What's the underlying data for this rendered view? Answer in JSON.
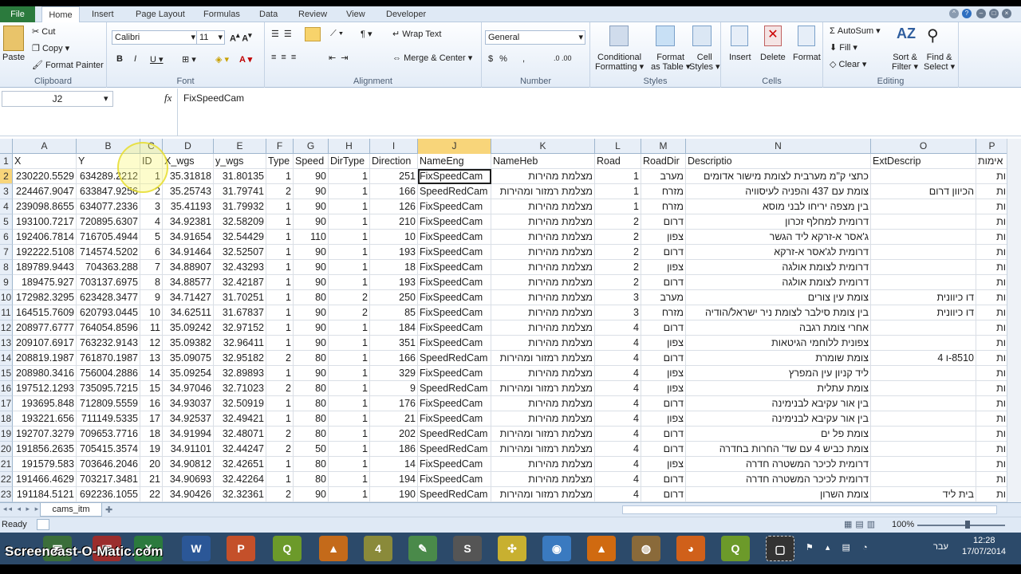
{
  "tabs": [
    "File",
    "Home",
    "Insert",
    "Page Layout",
    "Formulas",
    "Data",
    "Review",
    "View",
    "Developer"
  ],
  "clipboard": {
    "paste": "Paste",
    "cut": "Cut",
    "copy": "Copy",
    "format_painter": "Format Painter",
    "label": "Clipboard"
  },
  "font": {
    "name": "Calibri",
    "size": "11",
    "label": "Font"
  },
  "alignment": {
    "wrap": "Wrap Text",
    "merge": "Merge & Center",
    "label": "Alignment"
  },
  "number": {
    "format": "General",
    "label": "Number"
  },
  "styles": {
    "cond": "Conditional",
    "cond2": "Formatting",
    "fmt_table": "Format",
    "fmt_table2": "as Table",
    "cell_styles": "Cell",
    "cell_styles2": "Styles",
    "label": "Styles"
  },
  "cells": {
    "insert": "Insert",
    "delete": "Delete",
    "format": "Format",
    "label": "Cells"
  },
  "editing": {
    "autosum": "AutoSum",
    "fill": "Fill",
    "clear": "Clear",
    "sort": "Sort &",
    "sort2": "Filter",
    "find": "Find &",
    "find2": "Select",
    "label": "Editing"
  },
  "formula_bar": {
    "name_box": "J2",
    "fx": "fx",
    "content": "FixSpeedCam"
  },
  "columns": [
    "A",
    "B",
    "C",
    "D",
    "E",
    "F",
    "G",
    "H",
    "I",
    "J",
    "K",
    "L",
    "M",
    "N",
    "O",
    "P"
  ],
  "header_row": [
    "X",
    "Y",
    "ID",
    "X_wgs",
    "y_wgs",
    "Type",
    "Speed",
    "DirType",
    "Direction",
    "NameEng",
    "NameHeb",
    "Road",
    "RoadDir",
    "Descriptio",
    "ExtDescrip",
    "אימות"
  ],
  "rows": [
    [
      "230220.5529",
      "634289.2212",
      "1",
      "35.31818",
      "31.80135",
      "1",
      "90",
      "1",
      "251",
      "FixSpeedCam",
      "מצלמת מהירות",
      "1",
      "מערב",
      "כתצי ק\"מ מערבית לצומת מישור אדומים",
      "",
      "ות"
    ],
    [
      "224467.9047",
      "633847.9256",
      "2",
      "35.25743",
      "31.79741",
      "2",
      "90",
      "1",
      "166",
      "SpeedRedCam",
      "מצלמת רמזור ומהירות",
      "1",
      "מזרח",
      "צומת עם 437 והפניה לעיסוויה",
      "הכיוון דרום",
      "ות"
    ],
    [
      "239098.8655",
      "634077.2336",
      "3",
      "35.41193",
      "31.79932",
      "1",
      "90",
      "1",
      "126",
      "FixSpeedCam",
      "מצלמת מהירות",
      "1",
      "מזרח",
      "בין מצפה יריחו לבני מוסא",
      "",
      "ות"
    ],
    [
      "193100.7217",
      "720895.6307",
      "4",
      "34.92381",
      "32.58209",
      "1",
      "90",
      "1",
      "210",
      "FixSpeedCam",
      "מצלמת מהירות",
      "2",
      "דרום",
      "דרומית למחלף זכרון",
      "",
      "ות"
    ],
    [
      "192406.7814",
      "716705.4944",
      "5",
      "34.91654",
      "32.54429",
      "1",
      "110",
      "1",
      "10",
      "FixSpeedCam",
      "מצלמת מהירות",
      "2",
      "צפון",
      "ג'אסר א-זרקא ליד הגשר",
      "",
      "ות"
    ],
    [
      "192222.5108",
      "714574.5202",
      "6",
      "34.91464",
      "32.52507",
      "1",
      "90",
      "1",
      "193",
      "FixSpeedCam",
      "מצלמת מהירות",
      "2",
      "דרום",
      "דרומית לג'אסר א-זרקא",
      "",
      "ות"
    ],
    [
      "189789.9443",
      "704363.288",
      "7",
      "34.88907",
      "32.43293",
      "1",
      "90",
      "1",
      "18",
      "FixSpeedCam",
      "מצלמת מהירות",
      "2",
      "צפון",
      "דרומית לצומת אולגה",
      "",
      "ות"
    ],
    [
      "189475.927",
      "703137.6975",
      "8",
      "34.88577",
      "32.42187",
      "1",
      "90",
      "1",
      "193",
      "FixSpeedCam",
      "מצלמת מהירות",
      "2",
      "דרום",
      "דרומית לצומת אולגה",
      "",
      "ות"
    ],
    [
      "172982.3295",
      "623428.3477",
      "9",
      "34.71427",
      "31.70251",
      "1",
      "80",
      "2",
      "250",
      "FixSpeedCam",
      "מצלמת מהירות",
      "3",
      "מערב",
      "צומת עין צורים",
      "דו כיוונית",
      "ות"
    ],
    [
      "164515.7609",
      "620793.0445",
      "10",
      "34.62511",
      "31.67837",
      "1",
      "90",
      "2",
      "85",
      "FixSpeedCam",
      "מצלמת מהירות",
      "3",
      "מזרח",
      "בין צומת סילבר לצומת ניר ישראל/הודיה",
      "דו כיוונית",
      "ות"
    ],
    [
      "208977.6777",
      "764054.8596",
      "11",
      "35.09242",
      "32.97152",
      "1",
      "90",
      "1",
      "184",
      "FixSpeedCam",
      "מצלמת מהירות",
      "4",
      "דרום",
      "אחרי צומת רגבה",
      "",
      "ות"
    ],
    [
      "209107.6917",
      "763232.9143",
      "12",
      "35.09382",
      "32.96411",
      "1",
      "90",
      "1",
      "351",
      "FixSpeedCam",
      "מצלמת מהירות",
      "4",
      "צפון",
      "צפונית ללוחמי הגיטאות",
      "",
      "ות"
    ],
    [
      "208819.1987",
      "761870.1987",
      "13",
      "35.09075",
      "32.95182",
      "2",
      "80",
      "1",
      "166",
      "SpeedRedCam",
      "מצלמת רמזור ומהירות",
      "4",
      "דרום",
      "צומת שומרת",
      "8510-ו 4",
      "ות"
    ],
    [
      "208980.3416",
      "756004.2886",
      "14",
      "35.09254",
      "32.89893",
      "1",
      "90",
      "1",
      "329",
      "FixSpeedCam",
      "מצלמת מהירות",
      "4",
      "צפון",
      "ליד קניון עין המפרץ",
      "",
      "ות"
    ],
    [
      "197512.1293",
      "735095.7215",
      "15",
      "34.97046",
      "32.71023",
      "2",
      "80",
      "1",
      "9",
      "SpeedRedCam",
      "מצלמת רמזור ומהירות",
      "4",
      "צפון",
      "צומת עתלית",
      "",
      "ות"
    ],
    [
      "193695.848",
      "712809.5559",
      "16",
      "34.93037",
      "32.50919",
      "1",
      "80",
      "1",
      "176",
      "FixSpeedCam",
      "מצלמת מהירות",
      "4",
      "דרום",
      "בין אור עקיבא לבנימינה",
      "",
      "ות"
    ],
    [
      "193221.656",
      "711149.5335",
      "17",
      "34.92537",
      "32.49421",
      "1",
      "80",
      "1",
      "21",
      "FixSpeedCam",
      "מצלמת מהירות",
      "4",
      "צפון",
      "בין אור עקיבא לבנימינה",
      "",
      "ות"
    ],
    [
      "192707.3279",
      "709653.7716",
      "18",
      "34.91994",
      "32.48071",
      "2",
      "80",
      "1",
      "202",
      "SpeedRedCam",
      "מצלמת רמזור ומהירות",
      "4",
      "דרום",
      "צומת פל ים",
      "",
      "ות"
    ],
    [
      "191856.2635",
      "705415.3574",
      "19",
      "34.91101",
      "32.44247",
      "2",
      "50",
      "1",
      "186",
      "SpeedRedCam",
      "מצלמת רמזור ומהירות",
      "4",
      "דרום",
      "צומת כביש 4 עם שד' החרות בחדרה",
      "",
      "ות"
    ],
    [
      "191579.583",
      "703646.2046",
      "20",
      "34.90812",
      "32.42651",
      "1",
      "80",
      "1",
      "14",
      "FixSpeedCam",
      "מצלמת מהירות",
      "4",
      "צפון",
      "דרומית לכיכר המשטרה חדרה",
      "",
      "ות"
    ],
    [
      "191466.4629",
      "703217.3481",
      "21",
      "34.90693",
      "32.42264",
      "1",
      "80",
      "1",
      "194",
      "FixSpeedCam",
      "מצלמת מהירות",
      "4",
      "דרום",
      "דרומית לכיכר המשטרה חדרה",
      "",
      "ות"
    ],
    [
      "191184.5121",
      "692236.1055",
      "22",
      "34.90426",
      "32.32361",
      "2",
      "90",
      "1",
      "190",
      "SpeedRedCam",
      "מצלמת רמזור ומהירות",
      "4",
      "דרום",
      "צומת השרון",
      "בית ליד",
      "ות"
    ]
  ],
  "sheet_tab": "cams_itm",
  "status": {
    "ready": "Ready",
    "zoom": "100%"
  },
  "taskbar": {
    "watermark": "Screencast-O-Matic.com",
    "lang": "עבר",
    "time": "12:28",
    "date": "17/07/2014"
  }
}
